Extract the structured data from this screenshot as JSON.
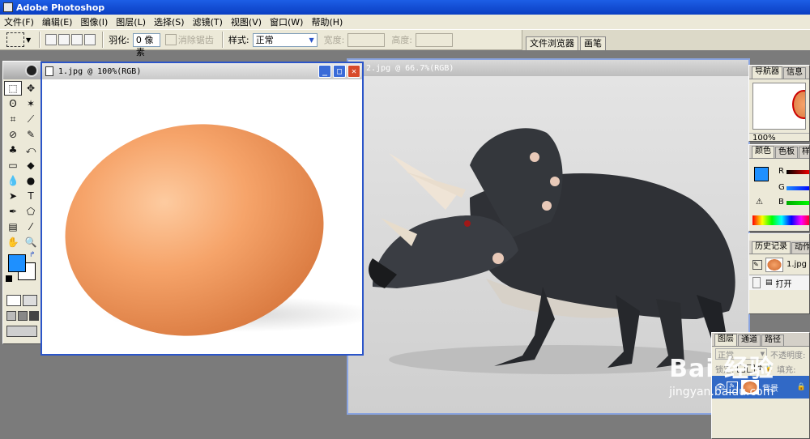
{
  "app": {
    "title": "Adobe Photoshop"
  },
  "menu": [
    "文件(F)",
    "编辑(E)",
    "图像(I)",
    "图层(L)",
    "选择(S)",
    "滤镜(T)",
    "视图(V)",
    "窗口(W)",
    "帮助(H)"
  ],
  "options": {
    "feather_label": "羽化:",
    "feather_value": "0 像素",
    "antialias_label": "消除锯齿",
    "style_label": "样式:",
    "style_value": "正常",
    "width_label": "宽度:",
    "height_label": "高度:",
    "well_tabs": [
      "文件浏览器",
      "画笔"
    ]
  },
  "documents": {
    "egg": {
      "title": "1.jpg @ 100%(RGB)"
    },
    "dino": {
      "title": "2.jpg @ 66.7%(RGB)"
    }
  },
  "navigator": {
    "tabs": [
      "导航器",
      "信息"
    ],
    "zoom": "100%"
  },
  "color_panel": {
    "tabs": [
      "颜色",
      "色板",
      "样"
    ],
    "channels": [
      "R",
      "G",
      "B"
    ]
  },
  "history": {
    "tabs": [
      "历史记录",
      "动作"
    ],
    "snapshot": "1.jpg",
    "step": "打开"
  },
  "layers": {
    "tabs": [
      "图层",
      "通道",
      "路径"
    ],
    "blend_mode": "正常",
    "opacity_label": "不透明度:",
    "lock_label": "锁定:",
    "fill_label": "填充:",
    "layer_name": "背景"
  },
  "watermark": {
    "logo": "Bai 经验",
    "url": "jingyan.baidu.com"
  },
  "colors": {
    "foreground": "#1e90ff",
    "background": "#ffffff",
    "title_blue": "#0a3ec2",
    "ui_face": "#ece9d8"
  }
}
